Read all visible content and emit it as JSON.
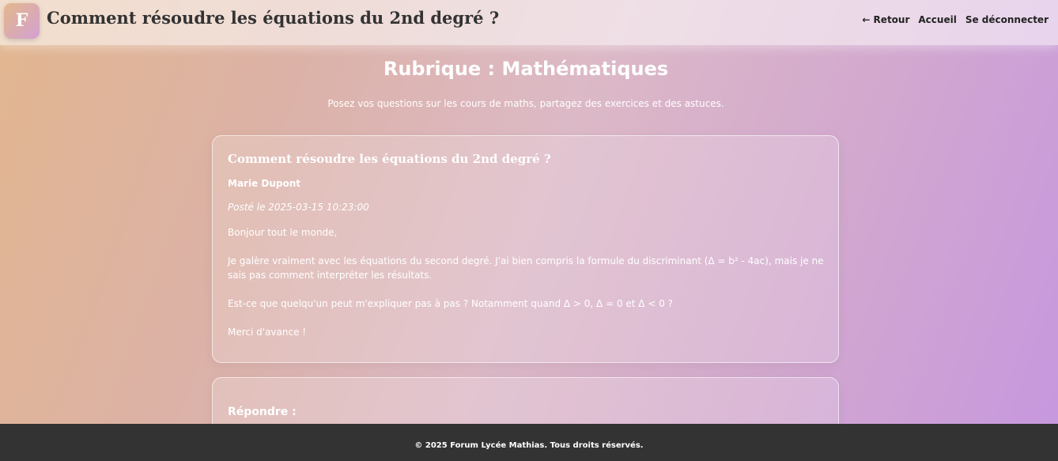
{
  "header": {
    "logo_letter": "F",
    "title": "Comment résoudre les équations du 2nd degré ?",
    "nav": {
      "back": "← Retour",
      "home": "Accueil",
      "logout": "Se déconnecter"
    }
  },
  "rubric": {
    "title": "Rubrique : Mathématiques",
    "description": "Posez vos questions sur les cours de maths, partagez des exercices et des astuces."
  },
  "post": {
    "title": "Comment résoudre les équations du 2nd degré ?",
    "author": "Marie Dupont",
    "date": "Posté le 2025-03-15 10:23:00",
    "body": [
      "Bonjour tout le monde,",
      "Je galère vraiment avec les équations du second degré. J'ai bien compris la formule du discriminant (Δ = b² - 4ac), mais je ne sais pas comment interpréter les résultats.",
      "Est-ce que quelqu'un peut m'expliquer pas à pas ? Notamment quand Δ > 0, Δ = 0 et Δ < 0 ?",
      "Merci d'avance !"
    ]
  },
  "reply": {
    "label": "Répondre :"
  },
  "footer": {
    "text": "© 2025 Forum Lycée Mathias. Tous droits réservés."
  }
}
